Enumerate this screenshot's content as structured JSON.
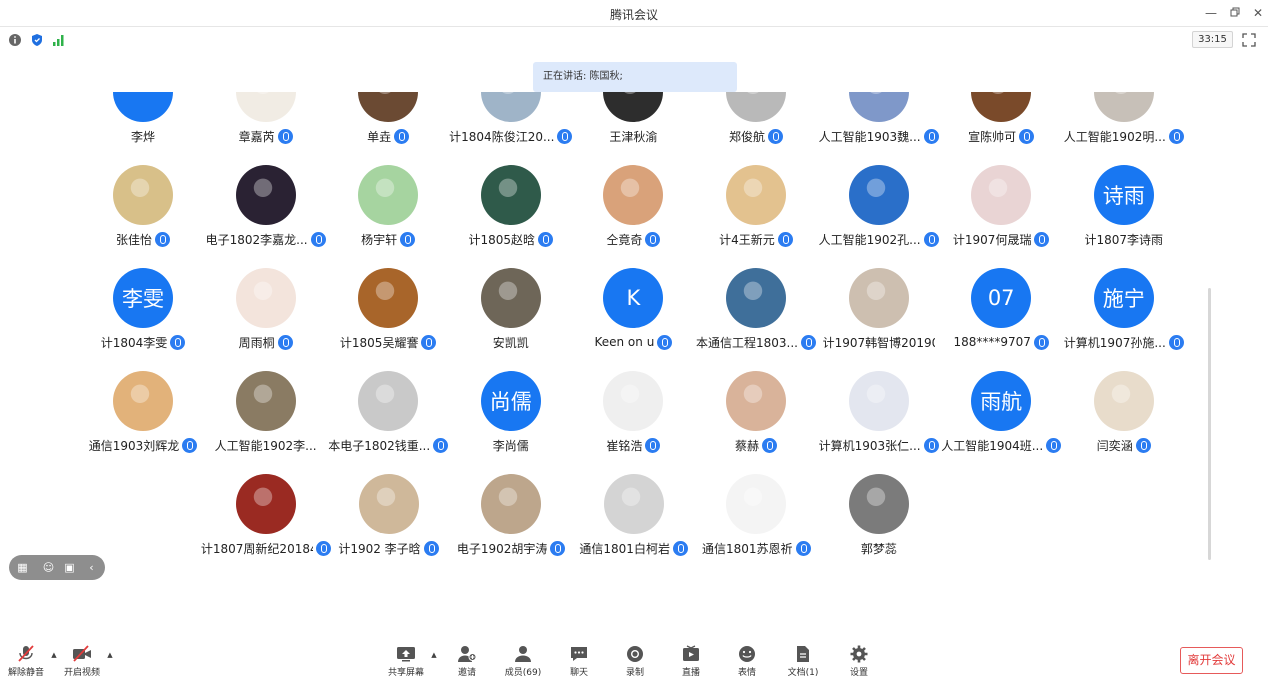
{
  "window": {
    "title": "腾讯会议"
  },
  "infobar": {
    "timer": "33:15"
  },
  "speaker": {
    "text": "正在讲话: 陈国秋;"
  },
  "participants": [
    {
      "name": "李烨",
      "avatar": {
        "kind": "text",
        "text": "",
        "color": "#1877f2"
      },
      "mic": false
    },
    {
      "name": "章嘉芮",
      "avatar": {
        "kind": "photo",
        "color": "#f1ece4"
      },
      "mic": true
    },
    {
      "name": "单垚",
      "avatar": {
        "kind": "photo",
        "color": "#6b4a33"
      },
      "mic": true
    },
    {
      "name": "计1804陈俊江20...",
      "avatar": {
        "kind": "photo",
        "color": "#9fb4c8"
      },
      "mic": true
    },
    {
      "name": "王津秋渝",
      "avatar": {
        "kind": "photo",
        "color": "#2d2d2d"
      },
      "mic": false
    },
    {
      "name": "郑俊航",
      "avatar": {
        "kind": "photo",
        "color": "#b9b9b9"
      },
      "mic": true
    },
    {
      "name": "人工智能1903魏...",
      "avatar": {
        "kind": "photo",
        "color": "#7f98c9"
      },
      "mic": true
    },
    {
      "name": "宣陈帅可",
      "avatar": {
        "kind": "photo",
        "color": "#7a4a2a"
      },
      "mic": true
    },
    {
      "name": "人工智能1902明...",
      "avatar": {
        "kind": "photo",
        "color": "#c7c0b8"
      },
      "mic": true
    },
    {
      "name": "张佳怡",
      "avatar": {
        "kind": "photo",
        "color": "#d8c089"
      },
      "mic": true
    },
    {
      "name": "电子1802李嘉龙...",
      "avatar": {
        "kind": "photo",
        "color": "#2a2233"
      },
      "mic": true
    },
    {
      "name": "杨宇轩",
      "avatar": {
        "kind": "photo",
        "color": "#a6d4a0"
      },
      "mic": true
    },
    {
      "name": "计1805赵晗",
      "avatar": {
        "kind": "photo",
        "color": "#2f5a4a"
      },
      "mic": true
    },
    {
      "name": "仝竟奇",
      "avatar": {
        "kind": "photo",
        "color": "#d9a27a"
      },
      "mic": true
    },
    {
      "name": "计4王新元",
      "avatar": {
        "kind": "photo",
        "color": "#e3c28f"
      },
      "mic": true
    },
    {
      "name": "人工智能1902孔...",
      "avatar": {
        "kind": "photo",
        "color": "#2a6fc9"
      },
      "mic": true
    },
    {
      "name": "计1907何晟瑞",
      "avatar": {
        "kind": "photo",
        "color": "#e9d4d4"
      },
      "mic": true
    },
    {
      "name": "计1807李诗雨",
      "avatar": {
        "kind": "text",
        "text": "诗雨",
        "color": "#1877f2"
      },
      "mic": false
    },
    {
      "name": "计1804李雯",
      "avatar": {
        "kind": "text",
        "text": "李雯",
        "color": "#1877f2"
      },
      "mic": true
    },
    {
      "name": "周雨桐",
      "avatar": {
        "kind": "photo",
        "color": "#f3e4dc"
      },
      "mic": true
    },
    {
      "name": "计1805吴耀謇",
      "avatar": {
        "kind": "photo",
        "color": "#a8652a"
      },
      "mic": true
    },
    {
      "name": "安凯凯",
      "avatar": {
        "kind": "photo",
        "color": "#6e6658"
      },
      "mic": false
    },
    {
      "name": "Keen on u",
      "avatar": {
        "kind": "text",
        "text": "K",
        "color": "#1877f2"
      },
      "mic": true
    },
    {
      "name": "本通信工程1803...",
      "avatar": {
        "kind": "photo",
        "color": "#3f6f9a"
      },
      "mic": true
    },
    {
      "name": "计1907韩智博20190...",
      "avatar": {
        "kind": "photo",
        "color": "#cdbfb0"
      },
      "mic": false
    },
    {
      "name": "188****9707",
      "avatar": {
        "kind": "text",
        "text": "07",
        "color": "#1877f2"
      },
      "mic": true
    },
    {
      "name": "计算机1907孙施...",
      "avatar": {
        "kind": "text",
        "text": "施宁",
        "color": "#1877f2"
      },
      "mic": true
    },
    {
      "name": "通信1903刘辉龙",
      "avatar": {
        "kind": "photo",
        "color": "#e2b27a"
      },
      "mic": true
    },
    {
      "name": "人工智能1902李...",
      "avatar": {
        "kind": "photo",
        "color": "#8a7b63"
      },
      "mic": false
    },
    {
      "name": "本电子1802钱重...",
      "avatar": {
        "kind": "photo",
        "color": "#c9c9c9"
      },
      "mic": true
    },
    {
      "name": "李尚儒",
      "avatar": {
        "kind": "text",
        "text": "尚儒",
        "color": "#1877f2"
      },
      "mic": false
    },
    {
      "name": "崔铭浩",
      "avatar": {
        "kind": "photo",
        "color": "#efefef"
      },
      "mic": true
    },
    {
      "name": "蔡赫",
      "avatar": {
        "kind": "photo",
        "color": "#d9b39a"
      },
      "mic": true
    },
    {
      "name": "计算机1903张仁...",
      "avatar": {
        "kind": "photo",
        "color": "#e3e6ef"
      },
      "mic": true
    },
    {
      "name": "人工智能1904班...",
      "avatar": {
        "kind": "text",
        "text": "雨航",
        "color": "#1877f2"
      },
      "mic": true
    },
    {
      "name": "闫奕涵",
      "avatar": {
        "kind": "photo",
        "color": "#e8dccb"
      },
      "mic": true
    },
    {
      "name": "计1807周新纪20184...",
      "avatar": {
        "kind": "photo",
        "color": "#9a2a22"
      },
      "mic": true
    },
    {
      "name": "计1902 李子晗",
      "avatar": {
        "kind": "photo",
        "color": "#cfb89a"
      },
      "mic": true
    },
    {
      "name": "电子1902胡宇涛",
      "avatar": {
        "kind": "photo",
        "color": "#bda68c"
      },
      "mic": true
    },
    {
      "name": "通信1801白柯岩",
      "avatar": {
        "kind": "photo",
        "color": "#d4d4d4"
      },
      "mic": true
    },
    {
      "name": "通信1801苏恩祈",
      "avatar": {
        "kind": "photo",
        "color": "#f4f4f4"
      },
      "mic": true
    },
    {
      "name": "郭梦蕊",
      "avatar": {
        "kind": "photo",
        "color": "#7b7b7b"
      },
      "mic": false
    }
  ],
  "toolbar": {
    "unmute": "解除静音",
    "start_video": "开启视频",
    "share_screen": "共享屏幕",
    "invite": "邀请",
    "members": "成员(69)",
    "chat": "聊天",
    "record": "录制",
    "live": "直播",
    "reactions": "表情",
    "documents": "文档(1)",
    "settings": "设置",
    "leave": "离开会议"
  },
  "colors": {
    "accent": "#1877f2",
    "danger": "#e23b3b",
    "banner": "#dde9fb"
  }
}
